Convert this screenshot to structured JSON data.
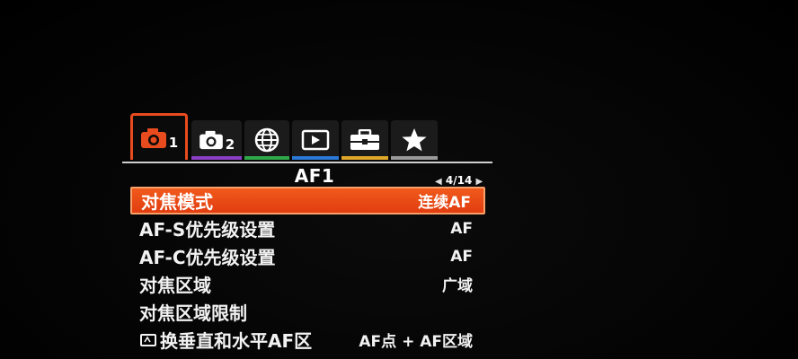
{
  "tabs": [
    {
      "id": "camera1",
      "icon": "camera-icon",
      "num": "1",
      "stripe": "#e84b1e",
      "active": true
    },
    {
      "id": "camera2",
      "icon": "camera-icon",
      "num": "2",
      "stripe": "#8a3fc6",
      "active": false
    },
    {
      "id": "network",
      "icon": "globe-icon",
      "num": "",
      "stripe": "#2fa84a",
      "active": false
    },
    {
      "id": "playback",
      "icon": "play-icon",
      "num": "",
      "stripe": "#2a78d8",
      "active": false
    },
    {
      "id": "setup",
      "icon": "toolbox-icon",
      "num": "",
      "stripe": "#e0a82a",
      "active": false
    },
    {
      "id": "mymenu",
      "icon": "star-icon",
      "num": "",
      "stripe": "#9a9a9a",
      "active": false
    }
  ],
  "header": {
    "title": "AF1",
    "page_indicator": "4/14"
  },
  "menu": {
    "items": [
      {
        "label": "对焦模式",
        "value": "连续AF",
        "selected": true
      },
      {
        "label": "AF-S优先级设置",
        "value": "AF",
        "selected": false
      },
      {
        "label": "AF-C优先级设置",
        "value": "AF",
        "selected": false
      },
      {
        "label": "对焦区域",
        "value": "广域",
        "selected": false
      },
      {
        "label": "对焦区域限制",
        "value": "",
        "selected": false
      },
      {
        "label": "换垂直和水平AF区",
        "value": "AF点 + AF区域",
        "selected": false,
        "icon": "rotate-frame-icon"
      }
    ]
  },
  "colors": {
    "accent": "#e84b1e",
    "background": "#050505"
  }
}
